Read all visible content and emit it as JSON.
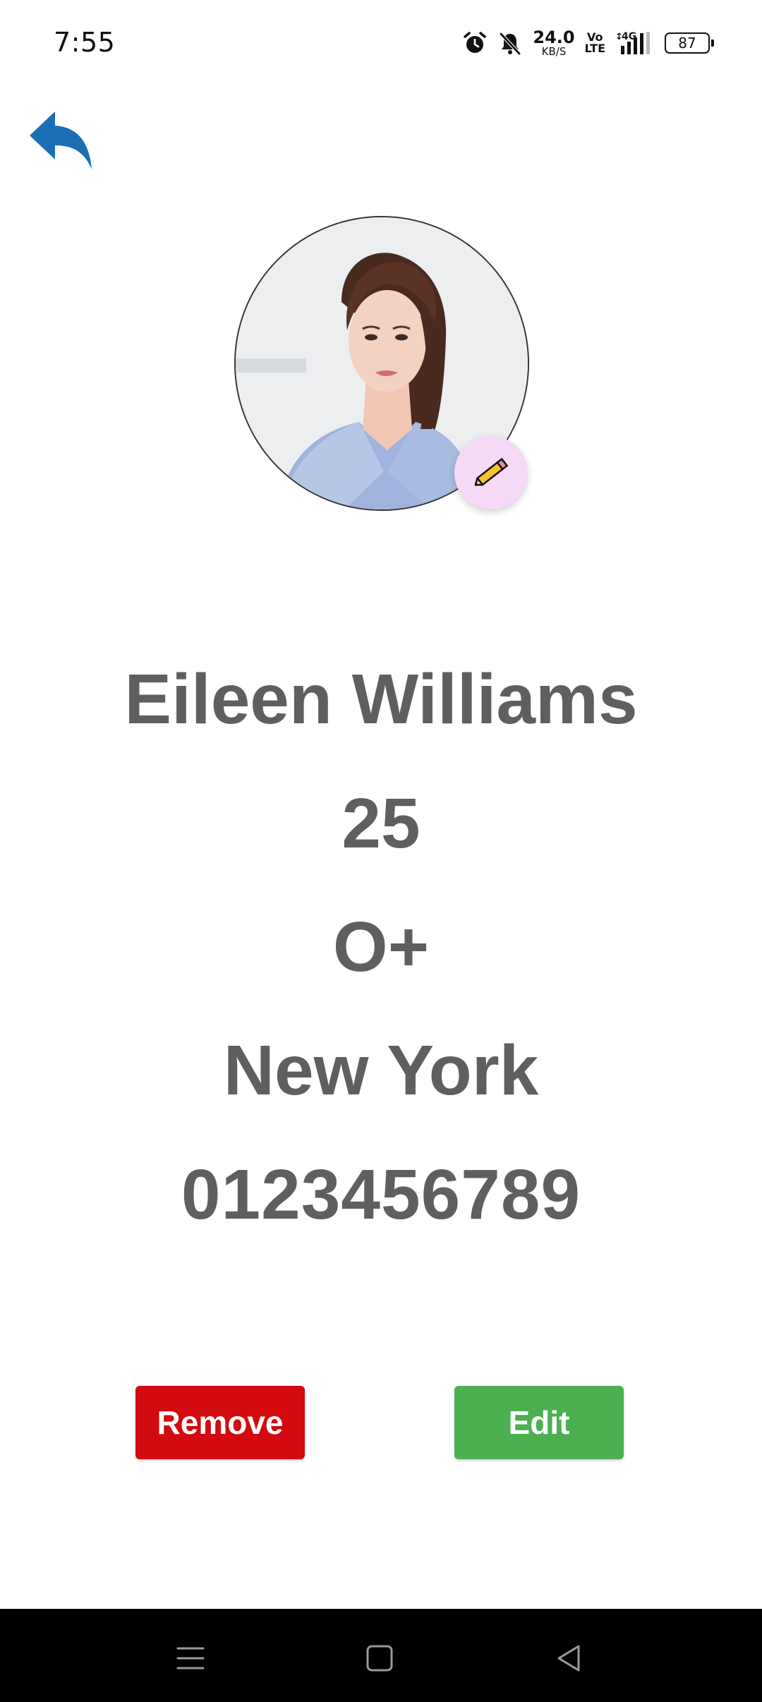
{
  "status_bar": {
    "time": "7:55",
    "net_speed_value": "24.0",
    "net_speed_unit": "KB/S",
    "volte_top": "Vo",
    "volte_bottom": "LTE",
    "network_type": "4G",
    "battery_level": "87",
    "icons": [
      "alarm-icon",
      "mute-icon",
      "signal-icon",
      "battery-icon"
    ]
  },
  "header": {
    "back_icon": "reply-arrow-icon",
    "back_color": "#1a6fb5"
  },
  "profile": {
    "avatar_icon": "profile-photo",
    "edit_photo_icon": "pencil-icon",
    "edit_photo_bg": "#f6d9f6",
    "name": "Eileen Williams",
    "age": "25",
    "blood_group": "O+",
    "city": "New York",
    "phone": "0123456789"
  },
  "actions": {
    "remove_label": "Remove",
    "edit_label": "Edit",
    "remove_color": "#d30a10",
    "edit_color": "#4caf50"
  },
  "nav_bar": {
    "icons": [
      "menu-icon",
      "home-icon",
      "back-triangle-icon"
    ]
  }
}
